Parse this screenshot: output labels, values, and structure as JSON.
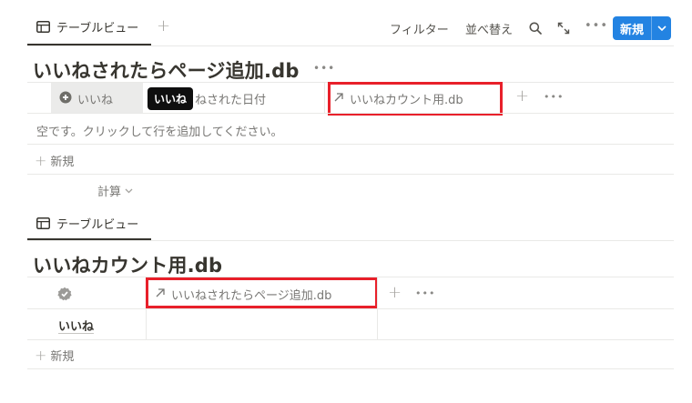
{
  "toolbar": {
    "view_tab_label": "テーブルビュー",
    "filter_label": "フィルター",
    "sort_label": "並べ替え",
    "new_label": "新規"
  },
  "db1": {
    "title": "いいねされたらページ追加.db",
    "columns": {
      "name_col": "いいね",
      "date_col_partial": "ねされた日付",
      "relation_col": "いいねカウント用.db"
    },
    "tooltip": "いいね",
    "empty_text": "空です。クリックして行を追加してください。",
    "new_row_label": "新規",
    "calc_label": "計算"
  },
  "view2": {
    "view_tab_label": "テーブルビュー"
  },
  "db2": {
    "title": "いいねカウント用.db",
    "relation_col": "いいねされたらページ追加.db",
    "rows": [
      {
        "name": "いいね"
      }
    ],
    "new_row_label": "新規"
  },
  "colors": {
    "accent": "#2383e2",
    "highlight_box": "#e8202a"
  }
}
